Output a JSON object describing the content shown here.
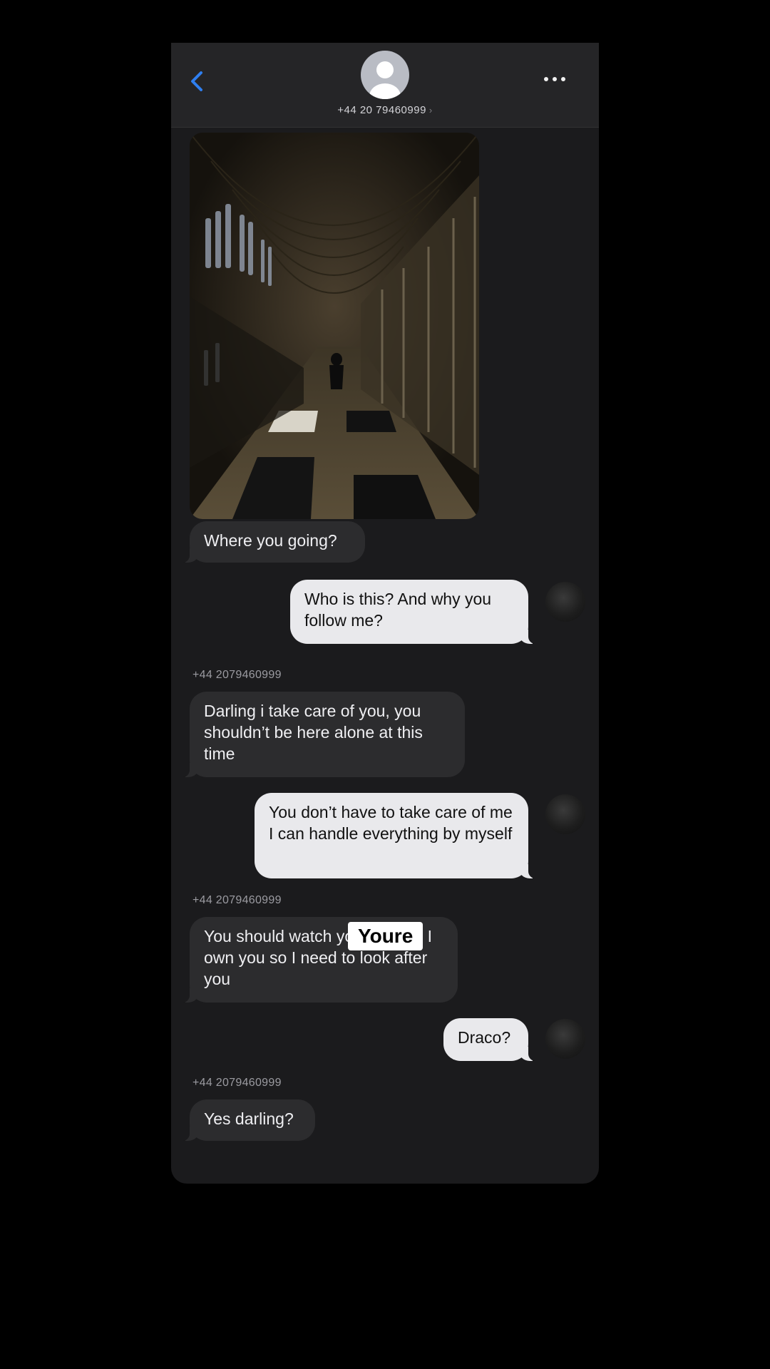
{
  "header": {
    "contact_number": "+44 20 79460999",
    "chevron": "›",
    "back_icon": "chevron-left-icon",
    "more_icon": "ellipsis-icon",
    "accent": "#2f7ff0"
  },
  "messages": [
    {
      "type": "image",
      "description_icon": "cloister-corridor-photo"
    },
    {
      "direction": "incoming",
      "text": "Where you going?"
    },
    {
      "direction": "outgoing",
      "text": "Who is this? And why you follow me?"
    },
    {
      "direction": "incoming",
      "sender": "+44 2079460999",
      "text": "Darling i take care of you, you shouldn’t be here alone at this time"
    },
    {
      "direction": "outgoing",
      "text": "You don’t have to take care of me I can handle everything by myself"
    },
    {
      "direction": "incoming",
      "sender": "+44 2079460999",
      "text": "You should watch your mouth, I own you so I need to look after you"
    },
    {
      "direction": "outgoing",
      "text": "Draco?"
    },
    {
      "direction": "incoming",
      "sender": "+44 2079460999",
      "text": "Yes darling?"
    }
  ],
  "caption_overlay": "Youre",
  "colors": {
    "background": "#000000",
    "chat_bg": "#1b1b1d",
    "incoming_bubble": "#2c2c2e",
    "outgoing_bubble": "#e9e9ec"
  }
}
